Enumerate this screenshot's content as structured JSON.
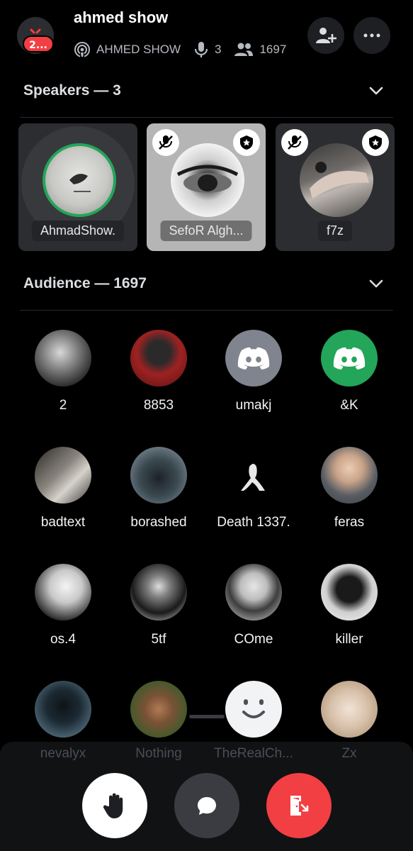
{
  "header": {
    "title": "ahmed show",
    "badge": "2...",
    "stage_name": "AHMED SHOW",
    "speaker_count": "3",
    "listener_count": "1697"
  },
  "speakers_section": {
    "title": "Speakers — 3"
  },
  "speakers": [
    {
      "name": "AhmadShow."
    },
    {
      "name": "SefoR Algh..."
    },
    {
      "name": "f7z"
    }
  ],
  "audience_section": {
    "title": "Audience — 1697"
  },
  "audience": [
    {
      "name": "2"
    },
    {
      "name": "8853"
    },
    {
      "name": "umakj"
    },
    {
      "name": "&K"
    },
    {
      "name": "badtext"
    },
    {
      "name": "borashed"
    },
    {
      "name": "Death 1337."
    },
    {
      "name": "feras"
    },
    {
      "name": "os.4"
    },
    {
      "name": "5tf"
    },
    {
      "name": "COme"
    },
    {
      "name": "killer"
    },
    {
      "name": "nevalyx"
    },
    {
      "name": "Nothing"
    },
    {
      "name": "TheRealCh..."
    },
    {
      "name": "Zx"
    }
  ],
  "colors": {
    "danger": "#f23f43",
    "discord_gray": "#80848e",
    "discord_green": "#23a55a",
    "speaking_ring": "#23a55a"
  },
  "icons": {
    "stage": "stage-icon",
    "mic": "mic-icon",
    "people": "people-icon",
    "invite": "add-user-icon",
    "more": "more-icon",
    "hand": "raise-hand-icon",
    "chat": "chat-icon",
    "leave": "leave-icon"
  }
}
